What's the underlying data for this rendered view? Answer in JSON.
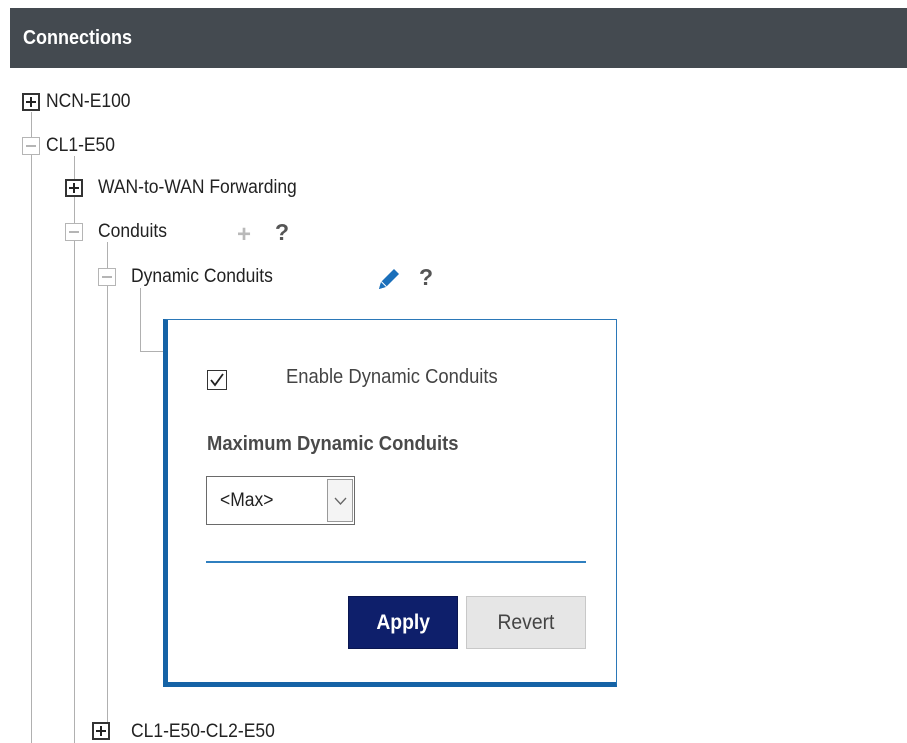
{
  "header": {
    "title": "Connections"
  },
  "tree": {
    "ncn": "NCN-E100",
    "site": "CL1-E50",
    "wan_forwarding": "WAN-to-WAN Forwarding",
    "conduits": "Conduits",
    "dynamic_conduits": "Dynamic Conduits",
    "next_conduit": "CL1-E50-CL2-E50",
    "help_symbol": "?",
    "add_symbol": "+"
  },
  "panel": {
    "enable_label": "Enable Dynamic Conduits",
    "enable_checked": true,
    "max_label": "Maximum Dynamic Conduits",
    "max_value": "<Max>",
    "apply_label": "Apply",
    "revert_label": "Revert"
  },
  "colors": {
    "header_bg": "#444a50",
    "panel_border": "#1563a6",
    "apply_bg": "#0e1f6b",
    "edit_icon": "#1a6fba"
  }
}
